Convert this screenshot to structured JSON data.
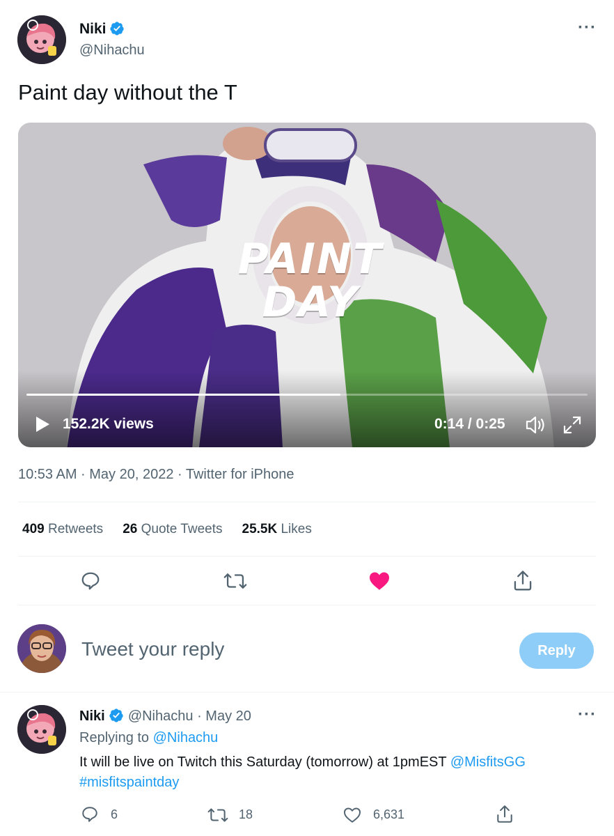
{
  "tweet": {
    "author_name": "Niki",
    "author_handle": "@Nihachu",
    "text": "Paint day without the T",
    "video": {
      "overlay_logo": "PAINT DAY",
      "views": "152.2K views",
      "time": "0:14 / 0:25",
      "progress_fraction": 0.56
    },
    "timestamp": "10:53 AM · May 20, 2022 · Twitter for iPhone",
    "stats": {
      "retweets_count": "409",
      "retweets_label": "Retweets",
      "quotes_count": "26",
      "quotes_label": "Quote Tweets",
      "likes_count": "25.5K",
      "likes_label": "Likes"
    },
    "liked": true
  },
  "composer": {
    "placeholder": "Tweet your reply",
    "reply_button": "Reply"
  },
  "reply": {
    "author_name": "Niki",
    "author_handle": "@Nihachu",
    "date": "May 20",
    "replying_prefix": "Replying to",
    "replying_to": "@Nihachu",
    "text": "It will be live on Twitch this Saturday (tomorrow) at 1pmEST",
    "mention": "@MisfitsGG",
    "hashtag": "#misfitspaintday",
    "reply_count": "6",
    "retweet_count": "18",
    "like_count": "6,631"
  },
  "colors": {
    "accent": "#1d9bf0",
    "like": "#f91880",
    "reply_button_disabled": "#8ecdf8"
  },
  "icons": [
    "more-icon",
    "verified-icon",
    "play-icon",
    "volume-icon",
    "fullscreen-icon",
    "reply-icon",
    "retweet-icon",
    "like-icon",
    "share-icon"
  ]
}
